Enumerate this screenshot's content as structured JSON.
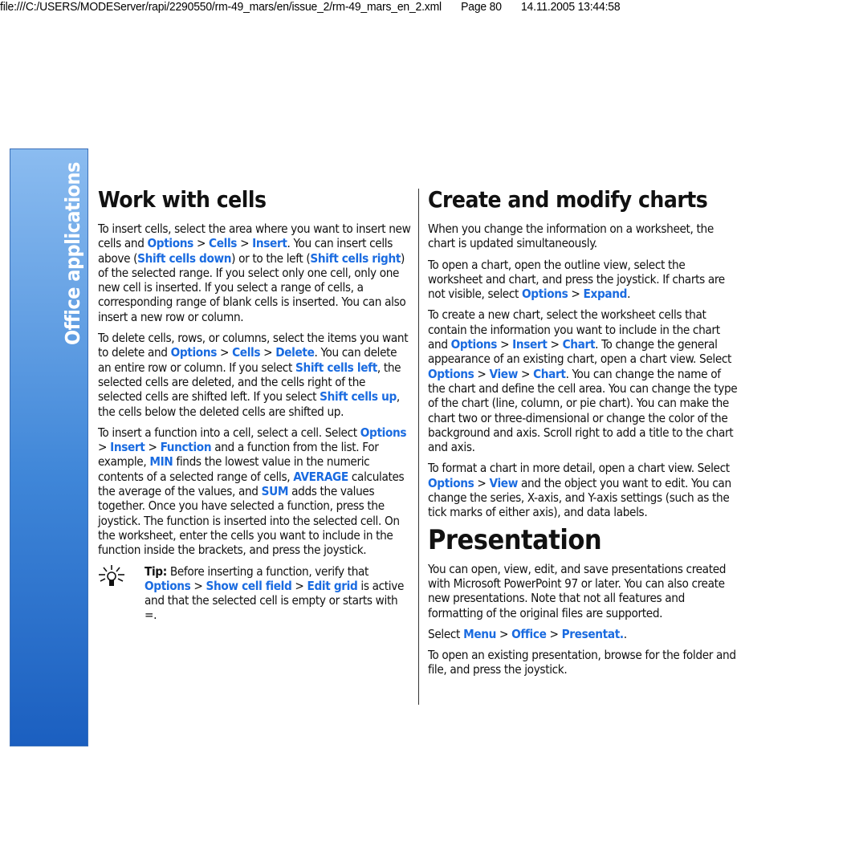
{
  "header": {
    "path": "file:///C:/USERS/MODEServer/rapi/2290550/rm-49_mars/en/issue_2/rm-49_mars_en_2.xml",
    "page": "Page 80",
    "timestamp": "14.11.2005 13:44:58"
  },
  "sidebar": {
    "section": "Office applications",
    "page_number": "80"
  },
  "colors": {
    "link": "#1a6be0",
    "sidebar_top": "#8bbcf0",
    "sidebar_bottom": "#1b5fc0"
  },
  "columns": [
    {
      "blocks": [
        {
          "type": "h",
          "text": "Work with cells"
        },
        {
          "type": "p",
          "segs": [
            {
              "t": "To insert cells, select the area where you want to insert new cells and "
            },
            {
              "t": "Options",
              "l": 1
            },
            {
              "t": " > "
            },
            {
              "t": "Cells",
              "l": 1
            },
            {
              "t": " > "
            },
            {
              "t": "Insert",
              "l": 1
            },
            {
              "t": ". You can insert cells above ("
            },
            {
              "t": "Shift cells down",
              "l": 1
            },
            {
              "t": ") or to the left ("
            },
            {
              "t": "Shift cells right",
              "l": 1
            },
            {
              "t": ") of the selected range. If you select only one cell, only one new cell is inserted. If you select a range of cells, a corresponding range of blank cells is inserted. You can also insert a new row or column."
            }
          ]
        },
        {
          "type": "p",
          "segs": [
            {
              "t": "To delete cells, rows, or columns, select the items you want to delete and "
            },
            {
              "t": "Options",
              "l": 1
            },
            {
              "t": " > "
            },
            {
              "t": "Cells",
              "l": 1
            },
            {
              "t": " > "
            },
            {
              "t": "Delete",
              "l": 1
            },
            {
              "t": ". You can delete an entire row or column. If you select "
            },
            {
              "t": "Shift cells left",
              "l": 1
            },
            {
              "t": ", the selected cells are deleted, and the cells right of the selected cells are shifted left. If you select "
            },
            {
              "t": "Shift cells up",
              "l": 1
            },
            {
              "t": ", the cells below the deleted cells are shifted up."
            }
          ]
        },
        {
          "type": "p",
          "segs": [
            {
              "t": "To insert a function into a cell, select a cell. Select "
            },
            {
              "t": "Options",
              "l": 1
            },
            {
              "t": " > "
            },
            {
              "t": "Insert",
              "l": 1
            },
            {
              "t": " > "
            },
            {
              "t": "Function",
              "l": 1
            },
            {
              "t": " and a function from the list. For example, "
            },
            {
              "t": "MIN",
              "l": 1
            },
            {
              "t": " finds the lowest value in the numeric contents of a selected range of cells, "
            },
            {
              "t": "AVERAGE",
              "l": 1
            },
            {
              "t": " calculates the average of the values, and "
            },
            {
              "t": "SUM",
              "l": 1
            },
            {
              "t": " adds the values together. Once you have selected a function, press the joystick. The function is inserted into the selected cell. On the worksheet, enter the cells you want to include in the function inside the brackets, and press the joystick."
            }
          ]
        },
        {
          "type": "tip",
          "segs": [
            {
              "t": "Tip:",
              "b": 1
            },
            {
              "t": " Before inserting a function, verify that "
            },
            {
              "t": "Options",
              "l": 1
            },
            {
              "t": " > "
            },
            {
              "t": "Show cell field",
              "l": 1
            },
            {
              "t": " > "
            },
            {
              "t": "Edit grid",
              "l": 1
            },
            {
              "t": " is active and that the selected cell is empty or starts with =."
            }
          ]
        }
      ]
    },
    {
      "blocks": [
        {
          "type": "h",
          "text": "Create and modify charts"
        },
        {
          "type": "p",
          "segs": [
            {
              "t": "When you change the information on a worksheet, the chart is updated simultaneously."
            }
          ]
        },
        {
          "type": "p",
          "segs": [
            {
              "t": "To open a chart, open the outline view, select the worksheet and chart, and press the joystick. If charts are not visible, select "
            },
            {
              "t": "Options",
              "l": 1
            },
            {
              "t": " > "
            },
            {
              "t": "Expand",
              "l": 1
            },
            {
              "t": "."
            }
          ]
        },
        {
          "type": "p",
          "segs": [
            {
              "t": "To create a new chart, select the worksheet cells that contain the information you want to include in the chart and "
            },
            {
              "t": "Options",
              "l": 1
            },
            {
              "t": " > "
            },
            {
              "t": "Insert",
              "l": 1
            },
            {
              "t": " > "
            },
            {
              "t": "Chart",
              "l": 1
            },
            {
              "t": ". To change the general appearance of an existing chart, open a chart view. Select "
            },
            {
              "t": "Options",
              "l": 1
            },
            {
              "t": " > "
            },
            {
              "t": "View",
              "l": 1
            },
            {
              "t": " > "
            },
            {
              "t": "Chart",
              "l": 1
            },
            {
              "t": ". You can change the name of the chart and define the cell area. You can change the type of the chart (line, column, or pie chart). You can make the chart two or three-dimensional or change the color of the background and axis. Scroll right to add a title to the chart and axis."
            }
          ]
        },
        {
          "type": "p",
          "segs": [
            {
              "t": "To format a chart in more detail, open a chart view. Select "
            },
            {
              "t": "Options",
              "l": 1
            },
            {
              "t": " > "
            },
            {
              "t": "View",
              "l": 1
            },
            {
              "t": " and the object you want to edit. You can change the series, X-axis, and Y-axis settings (such as the tick marks of either axis), and data labels."
            }
          ]
        },
        {
          "type": "h2",
          "text": "Presentation"
        },
        {
          "type": "p",
          "segs": [
            {
              "t": "You can open, view, edit, and save presentations created with Microsoft PowerPoint 97 or later. You can also create new presentations. Note that not all features and formatting of the original files are supported."
            }
          ]
        },
        {
          "type": "p",
          "segs": [
            {
              "t": "Select "
            },
            {
              "t": "Menu",
              "l": 1
            },
            {
              "t": " > "
            },
            {
              "t": "Office",
              "l": 1
            },
            {
              "t": " > "
            },
            {
              "t": "Presentat.",
              "l": 1
            },
            {
              "t": "."
            }
          ]
        },
        {
          "type": "p",
          "segs": [
            {
              "t": "To open an existing presentation, browse for the folder and file, and press the joystick."
            }
          ]
        }
      ]
    }
  ]
}
